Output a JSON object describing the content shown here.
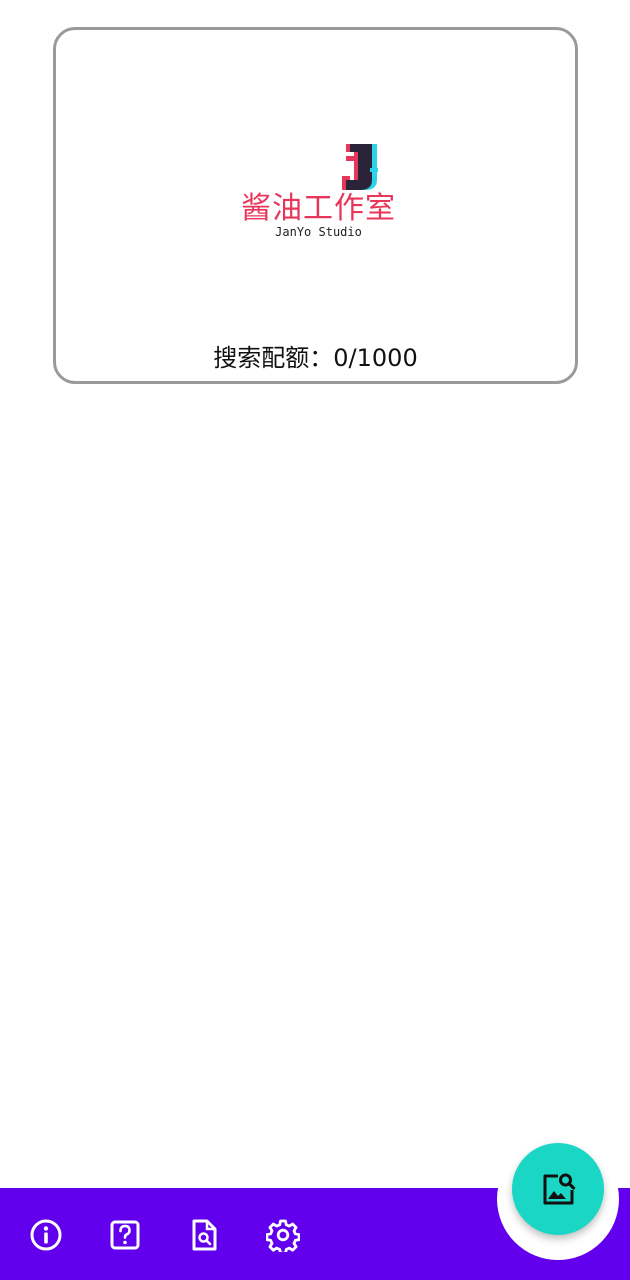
{
  "logo": {
    "mark": "J",
    "name_cn": "酱油工作室",
    "name_en": "JanYo Studio"
  },
  "quota": {
    "text": "搜索配额：0/1000"
  },
  "bottom_nav": {
    "items": [
      {
        "icon": "info-icon"
      },
      {
        "icon": "help-icon"
      },
      {
        "icon": "document-search-icon"
      },
      {
        "icon": "settings-icon"
      }
    ],
    "bar_color": "#6200ee"
  },
  "fab": {
    "icon": "image-search-icon",
    "color": "#1ad6c4"
  }
}
